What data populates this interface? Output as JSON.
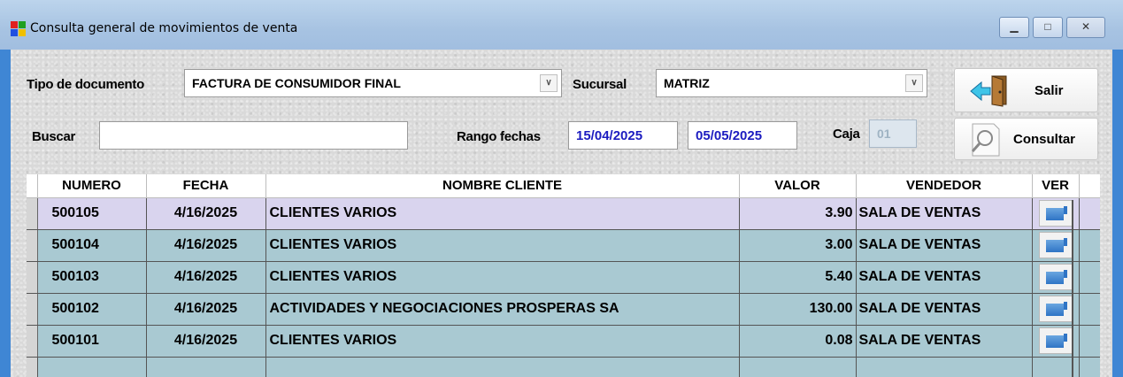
{
  "window": {
    "title": "Consulta general de movimientos de venta"
  },
  "form": {
    "tipo_documento_label": "Tipo de documento",
    "tipo_documento_value": "FACTURA DE CONSUMIDOR FINAL",
    "sucursal_label": "Sucursal",
    "sucursal_value": "MATRIZ",
    "buscar_label": "Buscar",
    "buscar_value": "",
    "rango_fechas_label": "Rango fechas",
    "fecha_desde": "15/04/2025",
    "fecha_hasta": "05/05/2025",
    "caja_label": "Caja",
    "caja_value": "01"
  },
  "buttons": {
    "salir": "Salir",
    "consultar": "Consultar"
  },
  "grid": {
    "columns": [
      "NUMERO",
      "FECHA",
      "NOMBRE CLIENTE",
      "VALOR",
      "VENDEDOR",
      "VER"
    ],
    "rows": [
      {
        "numero": "500105",
        "fecha": "4/16/2025",
        "cliente": "CLIENTES VARIOS",
        "valor": "3.90",
        "vendedor": "SALA DE VENTAS"
      },
      {
        "numero": "500104",
        "fecha": "4/16/2025",
        "cliente": "CLIENTES VARIOS",
        "valor": "3.00",
        "vendedor": "SALA DE VENTAS"
      },
      {
        "numero": "500103",
        "fecha": "4/16/2025",
        "cliente": "CLIENTES VARIOS",
        "valor": "5.40",
        "vendedor": "SALA DE VENTAS"
      },
      {
        "numero": "500102",
        "fecha": "4/16/2025",
        "cliente": "ACTIVIDADES Y NEGOCIACIONES PROSPERAS SA",
        "valor": "130.00",
        "vendedor": "SALA DE VENTAS"
      },
      {
        "numero": "500101",
        "fecha": "4/16/2025",
        "cliente": "CLIENTES VARIOS",
        "valor": "0.08",
        "vendedor": "SALA DE VENTAS"
      }
    ]
  },
  "colors": {
    "row_bg": "#a9c9d2",
    "selected_row_bg": "#d9d4ee",
    "date_text": "#1c1cc0"
  },
  "icons": {
    "app": "app-icon",
    "exit": "exit-door-icon",
    "search": "magnifier-icon",
    "view": "view-document-icon"
  }
}
